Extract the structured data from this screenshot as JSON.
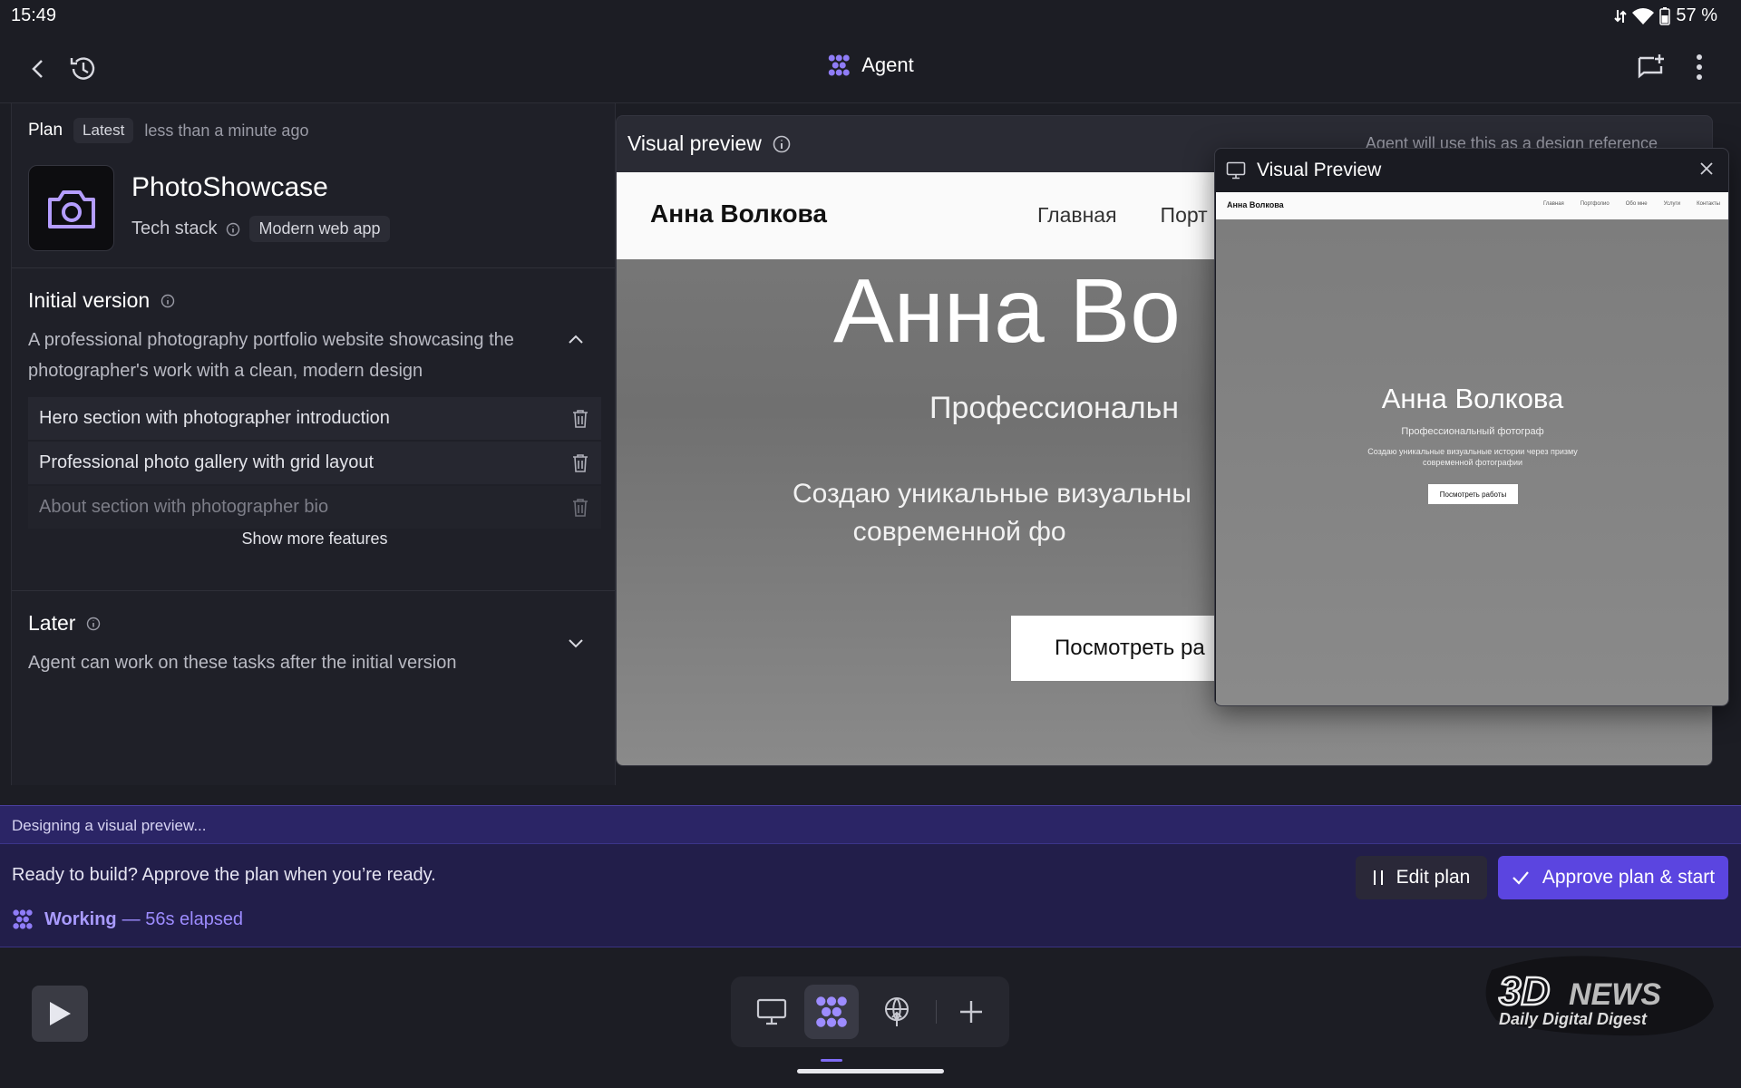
{
  "status": {
    "time": "15:49",
    "battery": "57 %"
  },
  "header": {
    "title": "Agent"
  },
  "plan": {
    "label": "Plan",
    "badge": "Latest",
    "updated": "less than a minute ago",
    "app_name": "PhotoShowcase",
    "tech_stack_label": "Tech stack",
    "tech_stack_value": "Modern web app",
    "initial": {
      "title": "Initial version",
      "description": "A professional photography portfolio website showcasing the photographer's work with a clean, modern design",
      "features": [
        "Hero section with photographer introduction",
        "Professional photo gallery with grid layout",
        "About section with photographer bio"
      ],
      "show_more": "Show more features"
    },
    "later": {
      "title": "Later",
      "description": "Agent can work on these tasks after the initial version"
    }
  },
  "preview": {
    "title": "Visual preview",
    "reference_note": "Agent will use this as a design reference",
    "site": {
      "brand": "Анна Волкова",
      "nav": [
        "Главная",
        "Порт"
      ],
      "hero_title": "Анна Во",
      "hero_subtitle": "Профессиональн",
      "hero_text": "Создаю уникальные визуальны\n        современной фо",
      "cta": "Посмотреть ра"
    }
  },
  "floating_preview": {
    "title": "Visual Preview",
    "site": {
      "brand": "Анна Волкова",
      "nav": [
        "Главная",
        "Портфолио",
        "Обо мне",
        "Услуги",
        "Контакты"
      ],
      "hero_title": "Анна Волкова",
      "hero_subtitle": "Профессиональный фотограф",
      "hero_text": "Создаю уникальные визуальные истории через призму современной фотографии",
      "cta": "Посмотреть работы"
    }
  },
  "banner": {
    "designing": "Designing a visual preview...",
    "ready": "Ready to build? Approve the plan when you’re ready.",
    "working_label": "Working",
    "elapsed": "— 56s elapsed",
    "edit_button": "Edit plan",
    "approve_button": "Approve plan & start"
  },
  "watermark": {
    "line1": "3DNEWS",
    "line2": "Daily Digital Digest"
  },
  "colors": {
    "accent": "#5b45e0",
    "agent_purple": "#8f7cf7",
    "banner_bg": "#221e4a"
  }
}
